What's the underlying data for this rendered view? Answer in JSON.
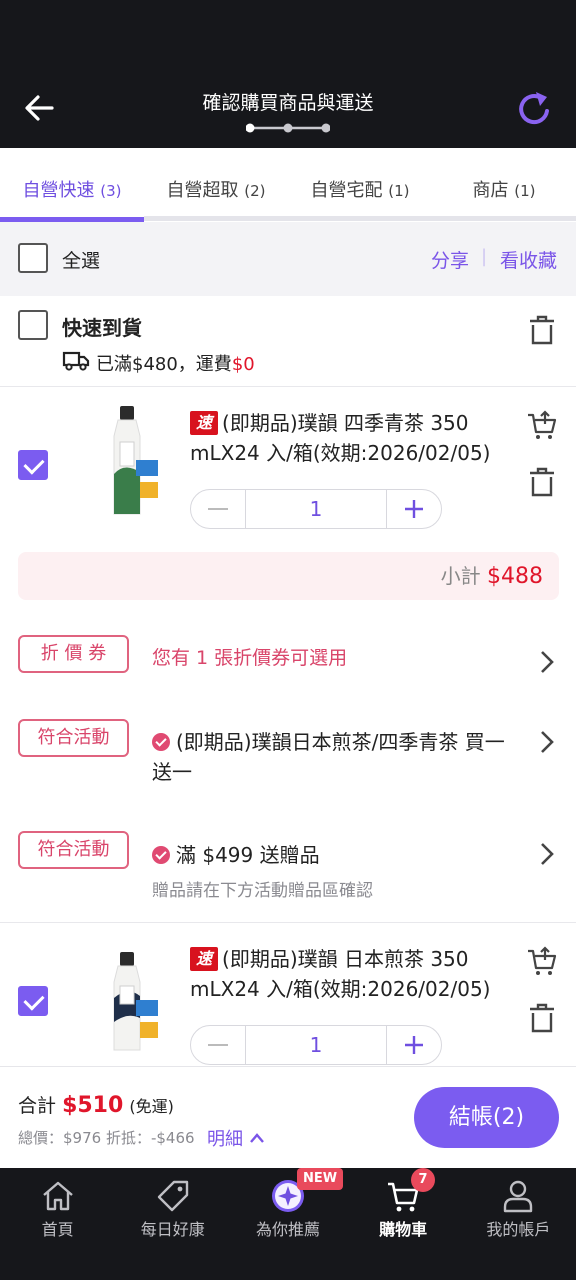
{
  "header": {
    "title": "確認購買商品與運送",
    "step_current": 1,
    "step_total": 3
  },
  "tabs": [
    {
      "label": "自營快速",
      "count": "(3)",
      "active": true
    },
    {
      "label": "自營超取",
      "count": "(2)"
    },
    {
      "label": "自營宅配",
      "count": "(1)"
    },
    {
      "label": "商店",
      "count": "(1)"
    }
  ],
  "select_all": {
    "label": "全選",
    "share": "分享",
    "divider": "|",
    "favorites": "看收藏"
  },
  "group": {
    "title": "快速到貨",
    "shipping_prefix": "已滿$480，運費",
    "shipping_fee": "$0",
    "icon": "truck-icon"
  },
  "items": [
    {
      "tag": "速",
      "name": "(即期品)璞韻 四季青茶 350 mLX24 入/箱(效期:2026/02/05)",
      "quantity": "1",
      "checked": true
    },
    {
      "tag": "速",
      "name": "(即期品)璞韻 日本煎茶 350 mLX24 入/箱(效期:2026/02/05)",
      "quantity": "1",
      "checked": true
    }
  ],
  "subtotal": {
    "label": "小計",
    "amount": "$488"
  },
  "coupon": {
    "tag": "折 價 券",
    "text": "您有 1 張折價券可選用"
  },
  "promos": [
    {
      "tag": "符合活動",
      "text": "(即期品)璞韻日本煎茶/四季青茶 買一送一"
    },
    {
      "tag": "符合活動",
      "text": "滿 $499 送贈品",
      "note": "贈品請在下方活動贈品區確認"
    }
  ],
  "summary": {
    "total_label": "合計",
    "total": "$510",
    "shipping_note": "(免運)",
    "detail_prefix": "總價：$976 折抵：-$466",
    "detail_link": "明細",
    "checkout": "結帳(2)"
  },
  "bottom_nav": [
    {
      "label": "首頁",
      "icon": "home-icon"
    },
    {
      "label": "每日好康",
      "icon": "tag-icon"
    },
    {
      "label": "為你推薦",
      "icon": "sparkle-icon",
      "badge": "NEW"
    },
    {
      "label": "購物車",
      "icon": "cart-icon",
      "badge": "7",
      "active": true
    },
    {
      "label": "我的帳戶",
      "icon": "user-icon"
    }
  ],
  "colors": {
    "accent": "#7b5cf0",
    "price_red": "#e0162b",
    "tag_pink": "#e0637f",
    "header_bg": "#16171b"
  }
}
